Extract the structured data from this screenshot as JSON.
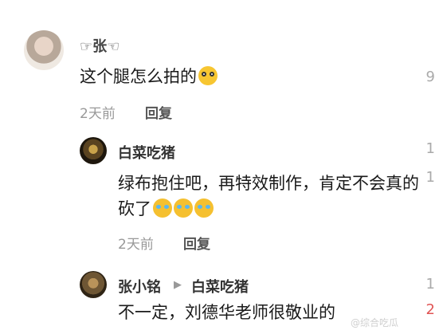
{
  "main_comment": {
    "user": "☞张☜",
    "text": "这个腿怎么拍的",
    "emoji": "flushed-face-icon",
    "time": "2天前",
    "reply_label": "回复"
  },
  "reply1": {
    "user": "白菜吃猪",
    "text": "绿布抱住吧，再特效制作，肯定不会真的砍了",
    "emojis": [
      "laughing-tears-icon",
      "laughing-tears-icon",
      "laughing-tears-icon"
    ],
    "time": "2天前",
    "reply_label": "回复"
  },
  "reply2": {
    "user": "张小铭",
    "target_user": "白菜吃猪",
    "text": "不一定，刘德华老师很敬业的"
  },
  "side_column": [
    "9",
    "1",
    "1",
    "1",
    "2"
  ],
  "watermark": "@综合吃瓜"
}
